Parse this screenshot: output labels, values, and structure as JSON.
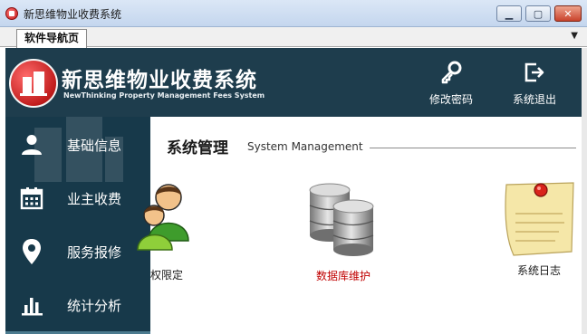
{
  "window": {
    "title": "新思维物业收费系统",
    "minimize": "▁",
    "maximize": "▢",
    "close": "✕"
  },
  "tabs": {
    "active": "软件导航页",
    "menu_arrow": "▼"
  },
  "header": {
    "title": "新思维物业收费系统",
    "subtitle": "NewThinking Property Management Fees System",
    "actions": [
      {
        "label": "修改密码",
        "icon": "key-icon"
      },
      {
        "label": "系统退出",
        "icon": "logout-icon"
      }
    ]
  },
  "sidebar": {
    "items": [
      {
        "label": "基础信息",
        "icon": "user-icon"
      },
      {
        "label": "业主收费",
        "icon": "calendar-icon"
      },
      {
        "label": "服务报修",
        "icon": "location-pin-icon"
      },
      {
        "label": "统计分析",
        "icon": "bar-chart-icon"
      }
    ]
  },
  "main": {
    "section_title": "系统管理",
    "section_en": "System Management",
    "tiles": [
      {
        "label": "权限定",
        "icon": "users-group-icon",
        "color": "#1a1a1a"
      },
      {
        "label": "数据库维护",
        "icon": "database-icon",
        "color": "#c00000"
      },
      {
        "label": "系统日志",
        "icon": "note-icon",
        "color": "#1a1a1a"
      }
    ]
  },
  "colors": {
    "header_bg": "#1e3d4d",
    "sidebar_bg": "#17394a",
    "accent_red": "#c00000"
  }
}
